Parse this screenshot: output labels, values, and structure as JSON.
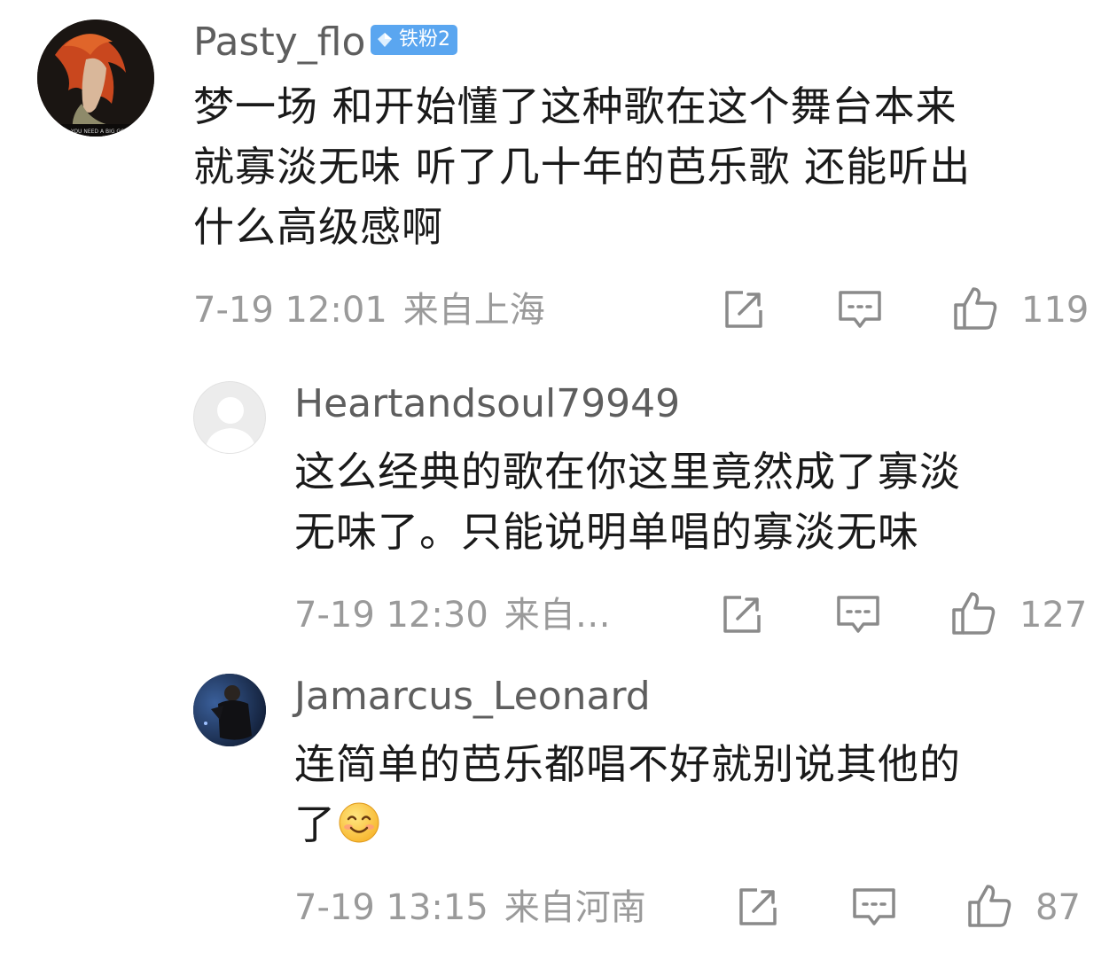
{
  "comments": [
    {
      "username": "Pasty_flo",
      "badge": "铁粉2",
      "avatar_caption": "YOU NEED A BIG GOD",
      "lines": [
        "梦一场 和开始懂了这种歌在这个舞台本来",
        "就寡淡无味 听了几十年的芭乐歌 还能听出",
        "什么高级感啊"
      ],
      "date": "7-19 12:01",
      "location": "来自上海",
      "likes": "119"
    },
    {
      "username": "Heartandsoul79949",
      "lines": [
        "这么经典的歌在你这里竟然成了寡淡",
        "无味了。只能说明单唱的寡淡无味"
      ],
      "date": "7-19 12:30",
      "location": "来自…",
      "likes": "127"
    },
    {
      "username": "Jamarcus_Leonard",
      "lines": [
        "连简单的芭乐都唱不好就别说其他的",
        "了"
      ],
      "date": "7-19 13:15",
      "location": "来自河南",
      "likes": "87"
    }
  ],
  "icons": {
    "share": "share-icon",
    "reply": "comment-icon",
    "like": "thumbs-up-icon",
    "emoji": "smile-emoji-icon",
    "badge_gem": "diamond-icon"
  },
  "colors": {
    "text": "#1a1a1a",
    "username": "#5e5e5e",
    "meta": "#9a9a9a",
    "badge": "#5aa6f0"
  }
}
